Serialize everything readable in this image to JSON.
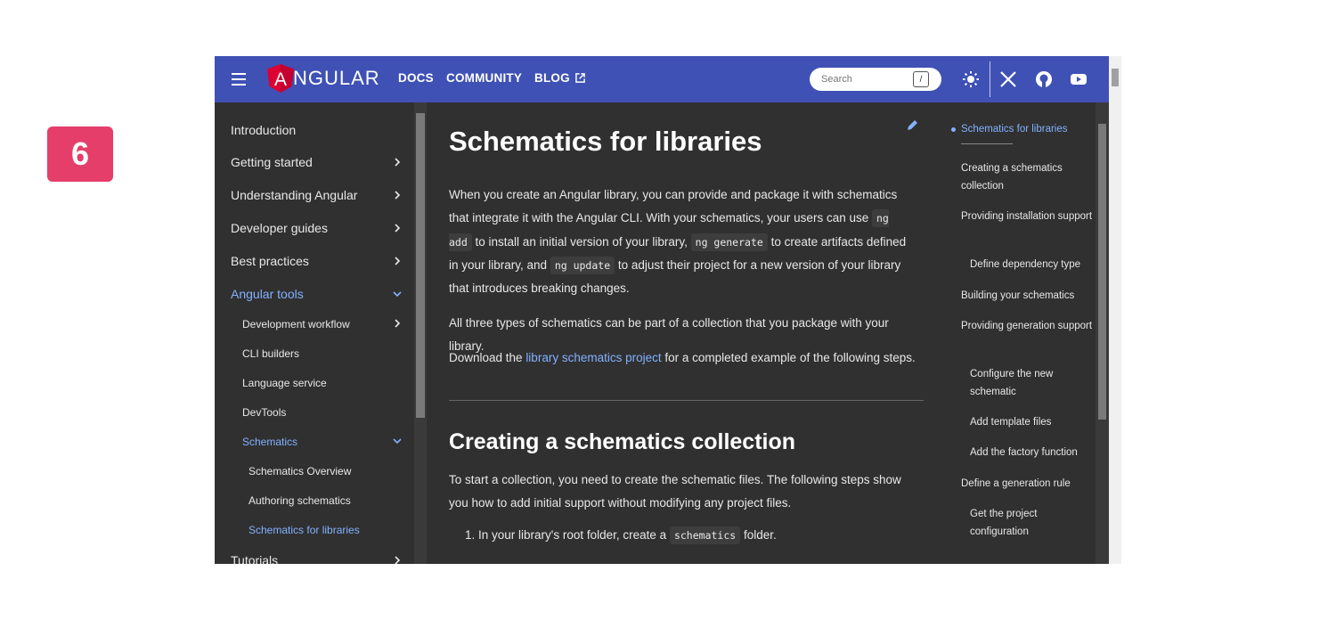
{
  "step_number": "6",
  "header": {
    "logo_text": "NGULAR",
    "logo_letter": "A",
    "nav": [
      "DOCS",
      "COMMUNITY",
      "BLOG"
    ],
    "search_placeholder": "Search",
    "search_shortcut": "/",
    "brand_color": "#3f51b5"
  },
  "sidebar": {
    "items": [
      {
        "label": "Introduction"
      },
      {
        "label": "Getting started"
      },
      {
        "label": "Understanding Angular"
      },
      {
        "label": "Developer guides"
      },
      {
        "label": "Best practices"
      },
      {
        "label": "Angular tools"
      },
      {
        "label": "Development workflow"
      },
      {
        "label": "CLI builders"
      },
      {
        "label": "Language service"
      },
      {
        "label": "DevTools"
      },
      {
        "label": "Schematics"
      },
      {
        "label": "Schematics Overview"
      },
      {
        "label": "Authoring schematics"
      },
      {
        "label": "Schematics for libraries"
      },
      {
        "label": "Tutorials"
      }
    ]
  },
  "main": {
    "title": "Schematics for libraries",
    "intro": {
      "t1": "When you create an Angular library, you can provide and package it with schematics that integrate it with the Angular CLI. With your schematics, your users can use ",
      "c1": "ng add",
      "t2": " to install an initial version of your library, ",
      "c2": "ng generate",
      "t3": " to create artifacts defined in your library, and ",
      "c3": "ng update",
      "t4": " to adjust their project for a new version of your library that introduces breaking changes."
    },
    "para2": "All three types of schematics can be part of a collection that you package with your library.",
    "para3": {
      "before": "Download the ",
      "link": "library schematics project",
      "after": " for a completed example of the following steps."
    },
    "section_title": "Creating a schematics collection",
    "section_para": "To start a collection, you need to create the schematic files. The following steps show you how to add initial support without modifying any project files.",
    "step1": {
      "before": "1. In your library's root folder, create a ",
      "code": "schematics",
      "after": " folder."
    }
  },
  "toc": {
    "items": [
      {
        "label": "Schematics for libraries"
      },
      {
        "label": "Creating a schematics collection"
      },
      {
        "label": "Providing installation support"
      },
      {
        "label": "Define dependency type"
      },
      {
        "label": "Building your schematics"
      },
      {
        "label": "Providing generation support"
      },
      {
        "label": "Configure the new schematic"
      },
      {
        "label": "Add template files"
      },
      {
        "label": "Add the factory function"
      },
      {
        "label": "Define a generation rule"
      },
      {
        "label": "Get the project configuration"
      }
    ]
  }
}
